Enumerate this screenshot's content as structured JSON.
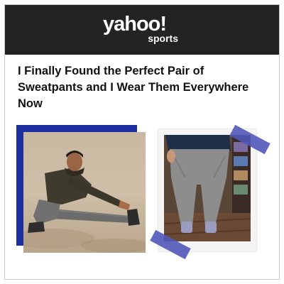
{
  "header": {
    "logo_main": "yahoo!",
    "logo_sub": "sports",
    "background_color": "#232323"
  },
  "article": {
    "headline": "I Finally Found the Perfect Pair of Sweatpants and I Wear Them Everywhere Now"
  },
  "images": {
    "left": {
      "description_icon": "man-stretching-photo",
      "accent_color": "#1b2f9e"
    },
    "right": {
      "description_icon": "sweatpants-mirror-photo",
      "tape_color": "#5158b8"
    }
  }
}
